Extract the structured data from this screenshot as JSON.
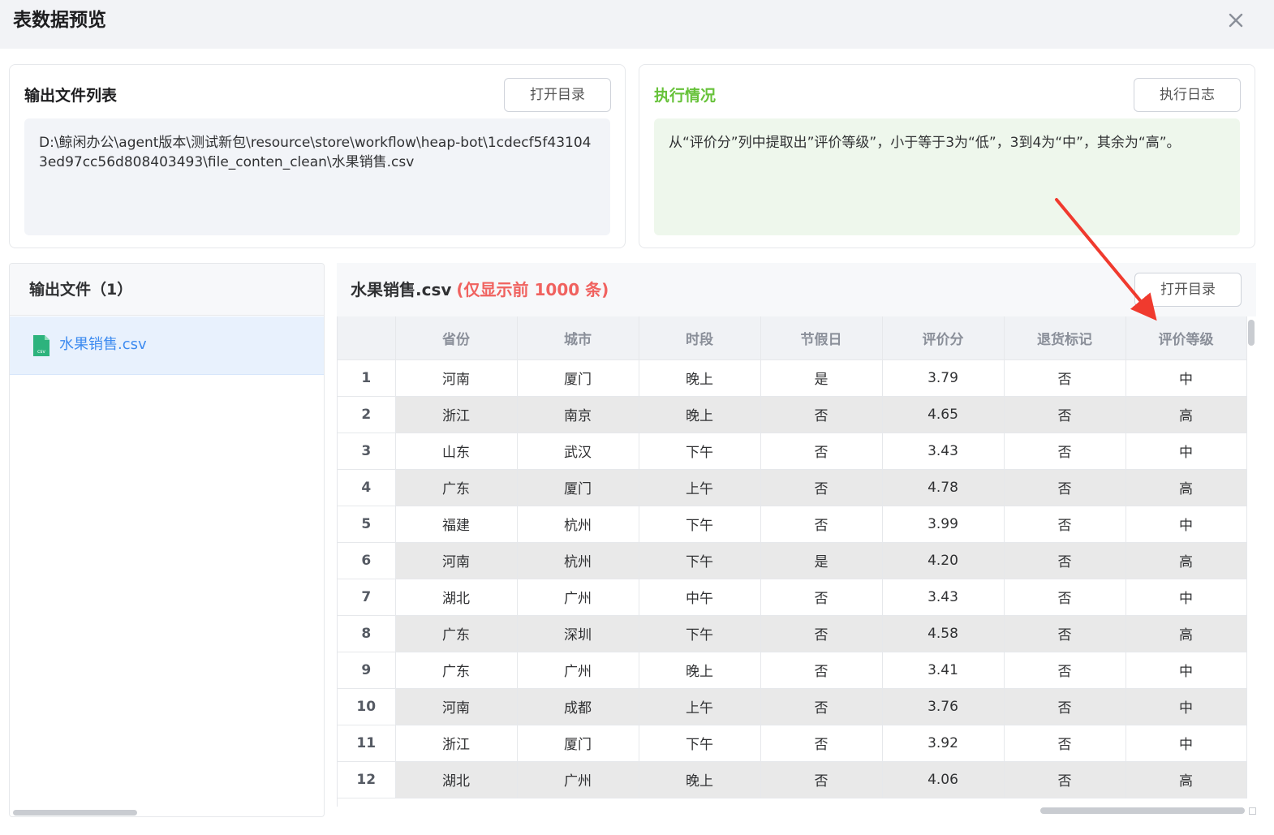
{
  "dialog": {
    "title": "表数据预览",
    "close_icon": "close-icon"
  },
  "output_files_card": {
    "title": "输出文件列表",
    "open_dir_label": "打开目录",
    "path": "D:\\鲸闲办公\\agent版本\\测试新包\\resource\\store\\workflow\\heap-bot\\1cdecf5f431043ed97cc56d808403493\\file_conten_clean\\水果销售.csv"
  },
  "execution_card": {
    "title": "执行情况",
    "title_color": "#67c23a",
    "log_label": "执行日志",
    "description": "从“评价分”列中提取出”评价等级”，小于等于3为“低”，3到4为“中”，其余为“高”。"
  },
  "left_panel": {
    "title": "输出文件（1）",
    "files": [
      {
        "name": "水果销售.csv",
        "icon": "csv-file-icon"
      }
    ]
  },
  "preview": {
    "file_name": "水果销售.csv",
    "limit_note": "(仅显示前 1000 条)",
    "limit_color": "#f0625f",
    "open_dir_label": "打开目录",
    "columns": [
      "省份",
      "城市",
      "时段",
      "节假日",
      "评价分",
      "退货标记",
      "评价等级"
    ],
    "rows": [
      {
        "index": "1",
        "cells": [
          "河南",
          "厦门",
          "晚上",
          "是",
          "3.79",
          "否",
          "中"
        ]
      },
      {
        "index": "2",
        "cells": [
          "浙江",
          "南京",
          "晚上",
          "否",
          "4.65",
          "否",
          "高"
        ]
      },
      {
        "index": "3",
        "cells": [
          "山东",
          "武汉",
          "下午",
          "否",
          "3.43",
          "否",
          "中"
        ]
      },
      {
        "index": "4",
        "cells": [
          "广东",
          "厦门",
          "上午",
          "否",
          "4.78",
          "否",
          "高"
        ]
      },
      {
        "index": "5",
        "cells": [
          "福建",
          "杭州",
          "下午",
          "否",
          "3.99",
          "否",
          "中"
        ]
      },
      {
        "index": "6",
        "cells": [
          "河南",
          "杭州",
          "下午",
          "是",
          "4.20",
          "否",
          "高"
        ]
      },
      {
        "index": "7",
        "cells": [
          "湖北",
          "广州",
          "中午",
          "否",
          "3.43",
          "否",
          "中"
        ]
      },
      {
        "index": "8",
        "cells": [
          "广东",
          "深圳",
          "下午",
          "否",
          "4.58",
          "否",
          "高"
        ]
      },
      {
        "index": "9",
        "cells": [
          "广东",
          "广州",
          "晚上",
          "否",
          "3.41",
          "否",
          "中"
        ]
      },
      {
        "index": "10",
        "cells": [
          "河南",
          "成都",
          "上午",
          "否",
          "3.76",
          "否",
          "中"
        ]
      },
      {
        "index": "11",
        "cells": [
          "浙江",
          "厦门",
          "下午",
          "否",
          "3.92",
          "否",
          "中"
        ]
      },
      {
        "index": "12",
        "cells": [
          "湖北",
          "广州",
          "晚上",
          "否",
          "4.06",
          "否",
          "高"
        ]
      }
    ]
  },
  "annotation": {
    "icon": "red-arrow-icon",
    "color": "#f03a2e"
  }
}
